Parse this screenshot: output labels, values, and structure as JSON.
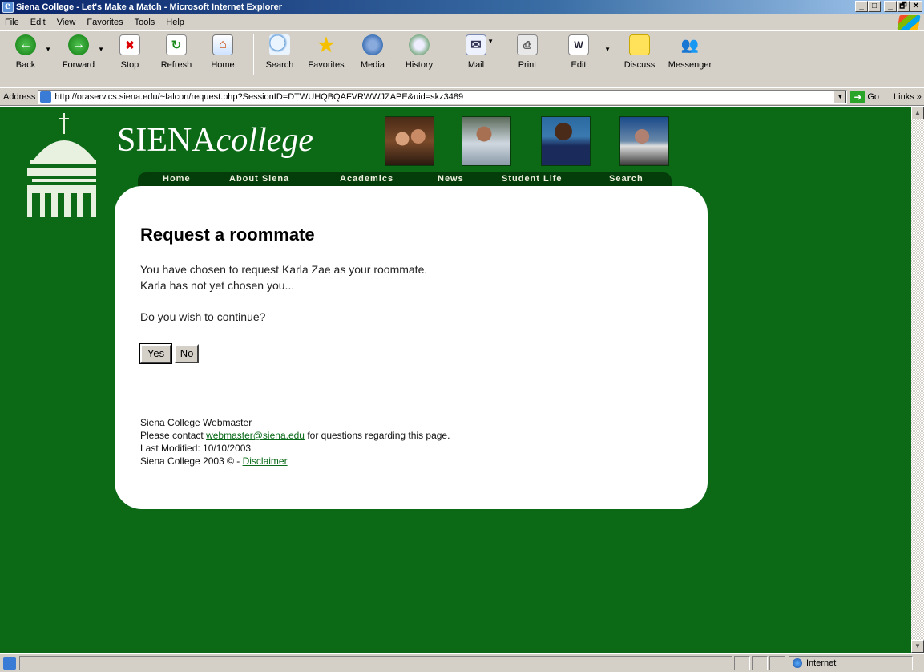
{
  "window": {
    "title": "Siena College - Let's Make a Match - Microsoft Internet Explorer",
    "buttons": [
      "_",
      "□",
      "_",
      "🗗",
      "✕"
    ]
  },
  "menu": [
    "File",
    "Edit",
    "View",
    "Favorites",
    "Tools",
    "Help"
  ],
  "toolbar": {
    "back": "Back",
    "forward": "Forward",
    "stop": "Stop",
    "refresh": "Refresh",
    "home": "Home",
    "search": "Search",
    "favorites": "Favorites",
    "media": "Media",
    "history": "History",
    "mail": "Mail",
    "print": "Print",
    "edit": "Edit",
    "discuss": "Discuss",
    "messenger": "Messenger"
  },
  "address": {
    "label": "Address",
    "url": "http://oraserv.cs.siena.edu/~falcon/request.php?SessionID=DTWUHQBQAFVRWWJZAPE&uid=skz3489",
    "go": "Go",
    "links": "Links"
  },
  "site": {
    "brand_main": "SIENA",
    "brand_italic": "college",
    "nav": [
      "Home",
      "About Siena",
      "Academics",
      "News",
      "Student Life",
      "Search"
    ]
  },
  "content": {
    "heading": "Request a roommate",
    "line1": "You have chosen to request Karla Zae as your roommate.",
    "line2": "Karla has not yet chosen you...",
    "question": "Do you wish to continue?",
    "yes": "Yes",
    "no": "No"
  },
  "footer": {
    "webmaster": "Siena College Webmaster",
    "contact_prefix": "Please contact ",
    "contact_email": "webmaster@siena.edu",
    "contact_suffix": " for questions regarding this page.",
    "modified": "Last Modified: 10/10/2003",
    "copyright": "Siena College 2003 © - ",
    "disclaimer": "Disclaimer"
  },
  "status": {
    "zone": "Internet"
  },
  "colors": {
    "page_bg": "#0c6a17",
    "nav_bg": "#053d0a",
    "link": "#0a6a1a"
  }
}
